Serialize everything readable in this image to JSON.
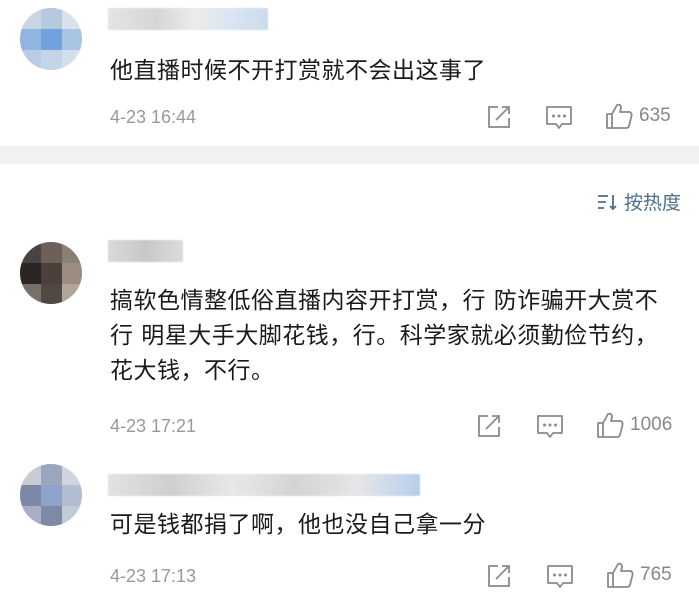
{
  "colors": {
    "divider": "#f1f1f1",
    "meta_text": "#999999",
    "sort_accent": "#4d6e8e"
  },
  "comments": [
    {
      "text": "他直播时候不开打赏就不会出这事了",
      "time": "4-23 16:44",
      "likes": "635"
    },
    {
      "text": "搞软色情整低俗直播内容开打赏，行 防诈骗开大赏不行 明星大手大脚花钱，行。科学家就必须勤俭节约，花大钱，不行。",
      "time": "4-23 17:21",
      "likes": "1006"
    },
    {
      "text": "可是钱都捐了啊，他也没自己拿一分",
      "time": "4-23 17:13",
      "likes": "765"
    }
  ],
  "sort": {
    "label": "按热度",
    "icon": "sort-icon"
  },
  "icons": {
    "share": "share-icon",
    "reply": "comment-icon",
    "like": "thumbs-up-icon"
  }
}
